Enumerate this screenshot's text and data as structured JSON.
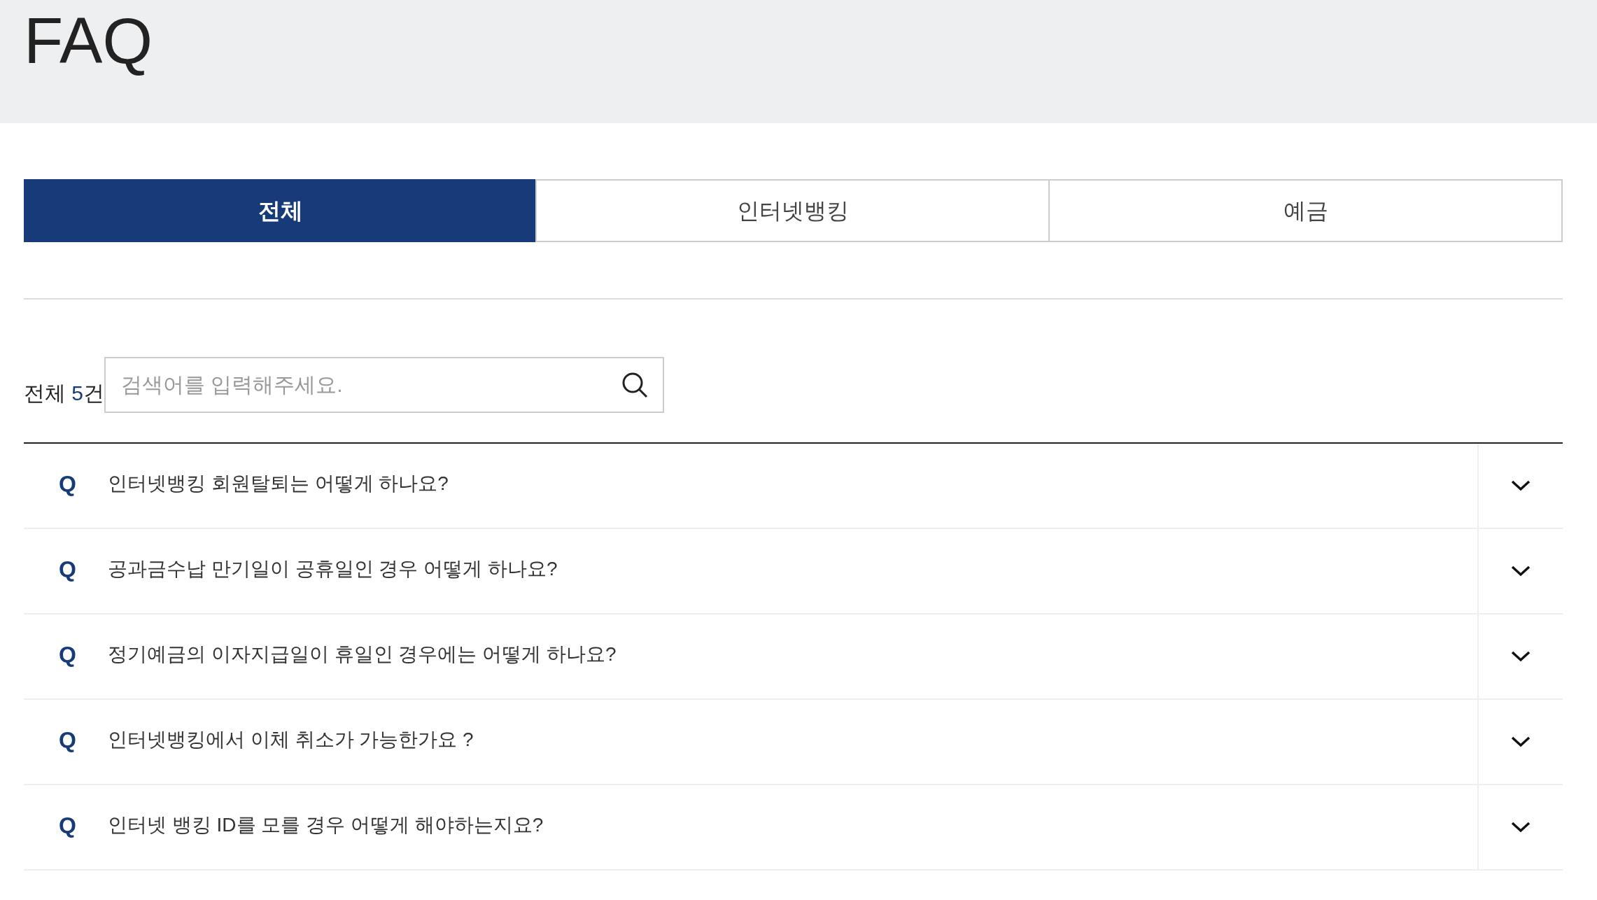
{
  "page": {
    "title": "FAQ"
  },
  "tabs": [
    {
      "label": "전체",
      "selected": true
    },
    {
      "label": "인터넷뱅킹",
      "selected": false
    },
    {
      "label": "예금",
      "selected": false
    }
  ],
  "count": {
    "label": "전체",
    "number": "5",
    "unit": "건"
  },
  "search": {
    "placeholder": "검색어를 입력해주세요."
  },
  "faq": [
    {
      "marker": "Q",
      "question": "인터넷뱅킹 회원탈퇴는 어떻게 하나요?",
      "expanded": false
    },
    {
      "marker": "Q",
      "question": "공과금수납 만기일이 공휴일인 경우 어떻게 하나요?",
      "expanded": false
    },
    {
      "marker": "Q",
      "question": "정기예금의 이자지급일이 휴일인 경우에는 어떻게 하나요?",
      "expanded": false
    },
    {
      "marker": "Q",
      "question": "인터넷뱅킹에서 이체 취소가 가능한가요 ?",
      "expanded": false
    },
    {
      "marker": "Q",
      "question": "인터넷 뱅킹 ID를 모를 경우 어떻게 해야하는지요?",
      "expanded": false
    }
  ]
}
